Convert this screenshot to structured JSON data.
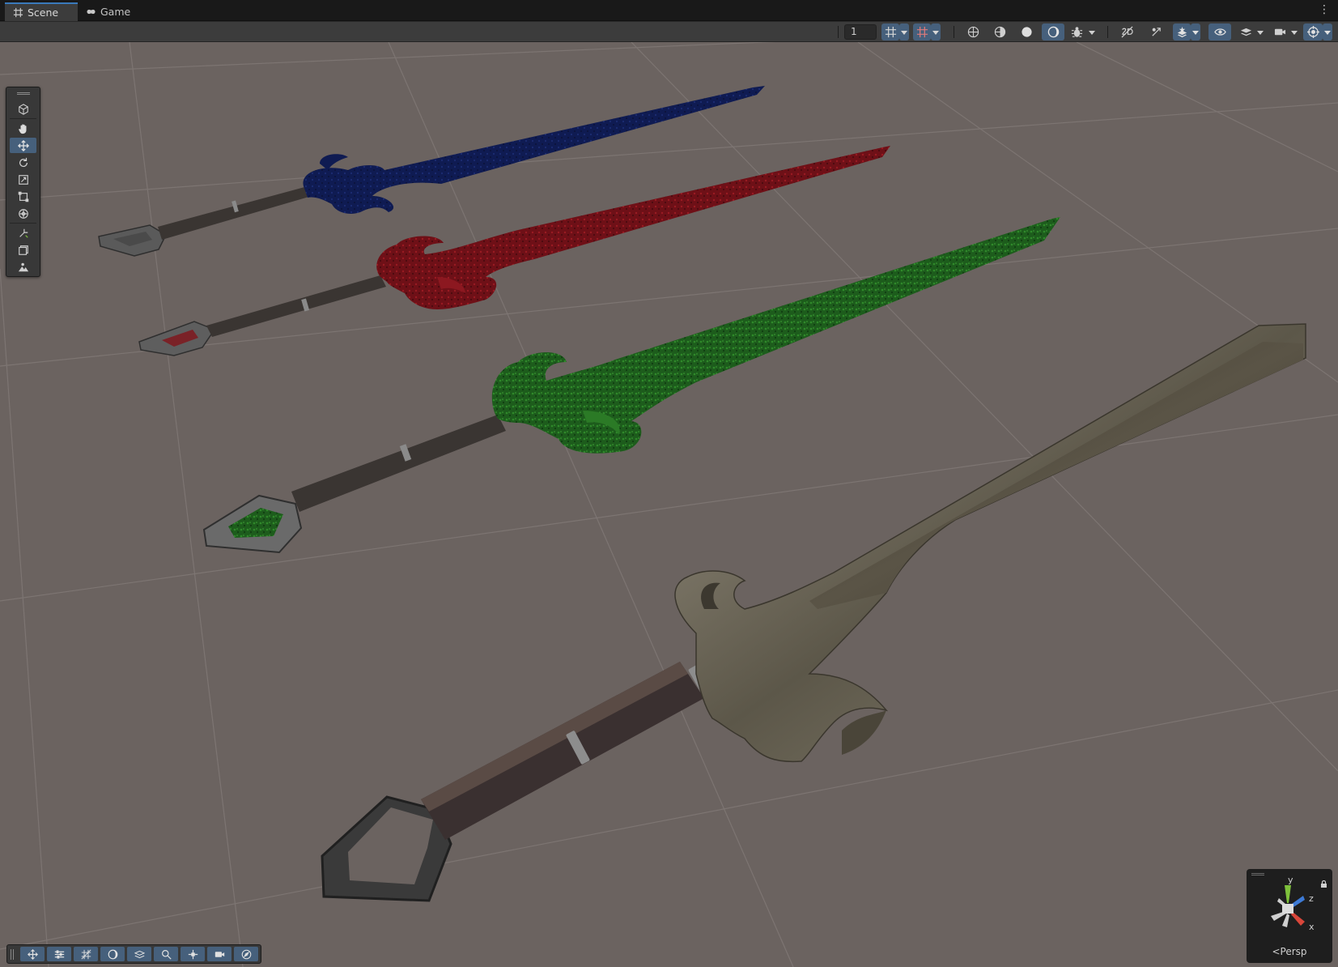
{
  "tabs": [
    {
      "label": "Scene",
      "icon": "grid-icon",
      "active": true
    },
    {
      "label": "Game",
      "icon": "gamepad-icon",
      "active": false
    }
  ],
  "toolbar": {
    "camera_speed_value": "1",
    "buttons": [
      "grid-snap-icon",
      "increment-snap-icon",
      "wireframe-shading-icon",
      "shaded-wireframe-icon",
      "shaded-icon",
      "unlit-icon",
      "debug-draw-icon",
      "2d-toggle-icon",
      "lighting-toggle-icon",
      "fx-toggle-icon",
      "scene-visibility-icon",
      "layers-icon",
      "camera-settings-icon",
      "gizmos-icon"
    ]
  },
  "tool_palette": [
    "view-tool-icon",
    "hand-tool-icon",
    "move-tool-icon",
    "rotate-tool-icon",
    "scale-tool-icon",
    "rect-tool-icon",
    "transform-tool-icon",
    "custom-tool-icon",
    "snap-tool-icon",
    "terrain-tool-icon"
  ],
  "bottom_toolbar": [
    "move-overlay-icon",
    "sliders-icon",
    "grid-overlay-icon",
    "shading-overlay-icon",
    "layers-overlay-icon",
    "search-icon",
    "pivot-icon",
    "camera-icon",
    "compass-icon"
  ],
  "gizmo": {
    "view_label": "Persp",
    "axis_labels": {
      "y": "y",
      "z": "z",
      "x": "x"
    },
    "colors": {
      "x": "#d9463a",
      "y": "#7ec13b",
      "z": "#3d7ad6",
      "neutral": "#cfcfcf"
    }
  },
  "scene": {
    "background": "#6b6360",
    "grid_color": "#7d7572",
    "swords": [
      {
        "name": "blue-sword",
        "blade_color": "#0f1b52"
      },
      {
        "name": "red-sword",
        "blade_color": "#6e1017"
      },
      {
        "name": "green-sword",
        "blade_color": "#1d5c1c"
      },
      {
        "name": "metal-sword",
        "blade_color": "#4b4537"
      }
    ]
  },
  "colors": {
    "tab_active_accent": "#3a79bb",
    "toolbar_bg": "#3c3c3c",
    "button_on": "#46607c"
  }
}
